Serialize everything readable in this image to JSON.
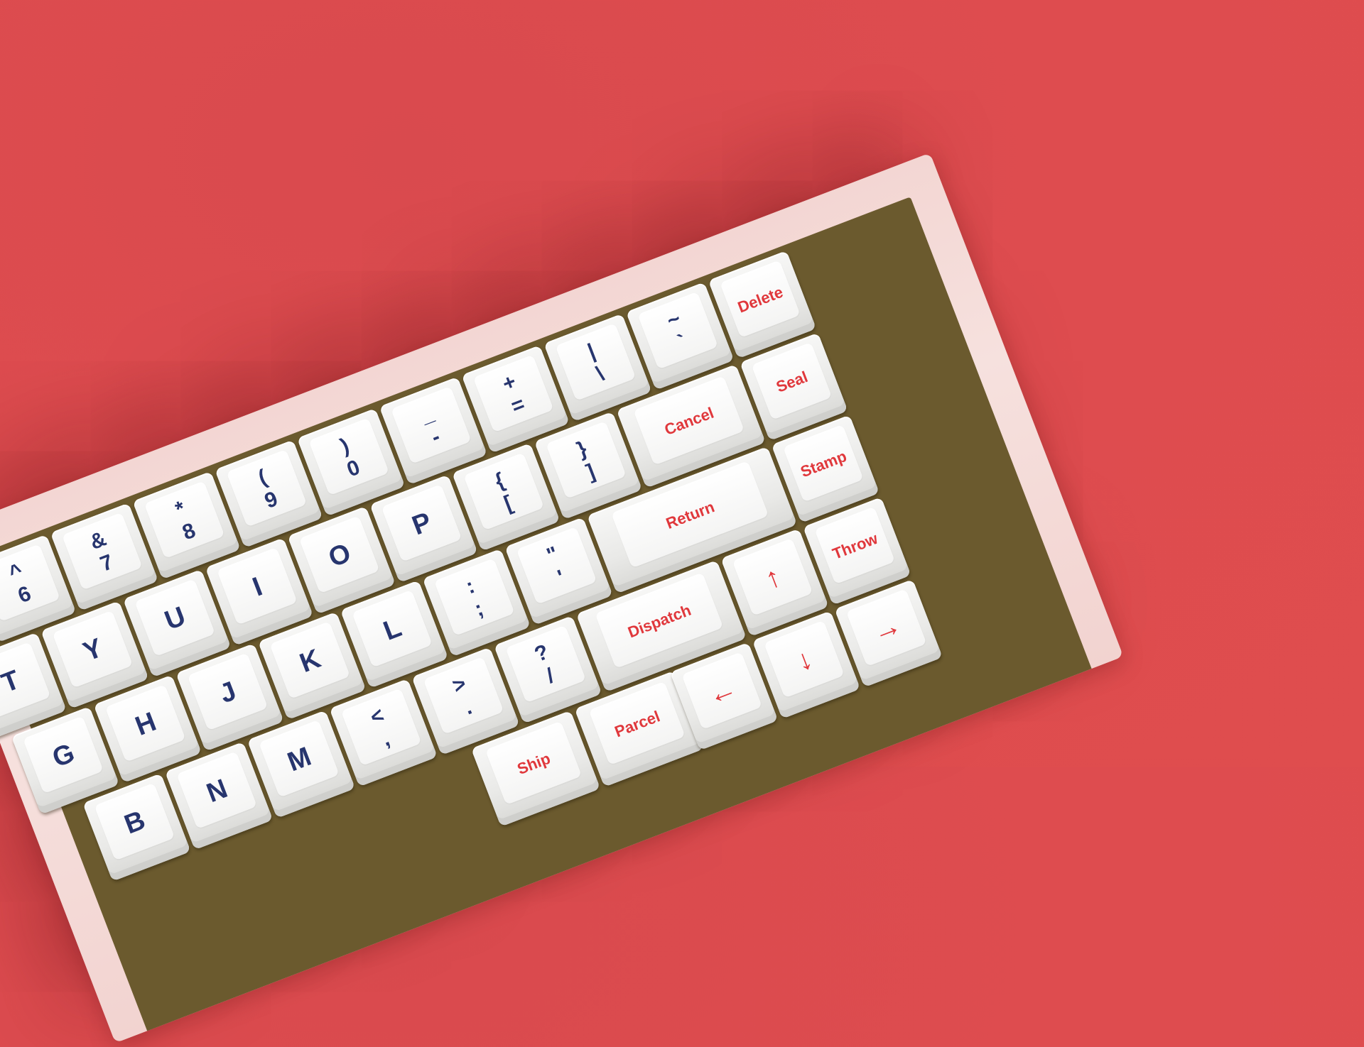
{
  "colors": {
    "background": "#de4c4f",
    "legend_blue": "#27356e",
    "legend_red": "#e0383c",
    "case": "#f4dcd9"
  },
  "rows": [
    [
      {
        "top": "^",
        "bottom": "6"
      },
      {
        "top": "&",
        "bottom": "7"
      },
      {
        "top": "*",
        "bottom": "8"
      },
      {
        "top": "(",
        "bottom": "9"
      },
      {
        "top": ")",
        "bottom": "0"
      },
      {
        "top": "_",
        "bottom": "-"
      },
      {
        "top": "+",
        "bottom": "="
      },
      {
        "top": "|",
        "bottom": "\\"
      },
      {
        "top": "~",
        "bottom": "`"
      },
      {
        "label": "Delete"
      }
    ],
    [
      {
        "label": "T"
      },
      {
        "label": "Y"
      },
      {
        "label": "U"
      },
      {
        "label": "I"
      },
      {
        "label": "O"
      },
      {
        "label": "P"
      },
      {
        "top": "{",
        "bottom": "["
      },
      {
        "top": "}",
        "bottom": "]"
      },
      {
        "label": "Cancel"
      },
      {
        "label": "Seal"
      }
    ],
    [
      {
        "label": "G"
      },
      {
        "label": "H"
      },
      {
        "label": "J"
      },
      {
        "label": "K"
      },
      {
        "label": "L"
      },
      {
        "top": ":",
        "bottom": ";"
      },
      {
        "top": "\"",
        "bottom": "'"
      },
      {
        "label": "Return"
      },
      {
        "label": "Stamp"
      }
    ],
    [
      {
        "label": "B"
      },
      {
        "label": "N"
      },
      {
        "label": "M"
      },
      {
        "top": "<",
        "bottom": ","
      },
      {
        "top": ">",
        "bottom": "."
      },
      {
        "top": "?",
        "bottom": "/"
      },
      {
        "label": "Dispatch"
      },
      {
        "label": "↑"
      },
      {
        "label": "Throw"
      }
    ],
    [
      {
        "label": "Ship"
      },
      {
        "label": "Parcel"
      },
      {
        "label": "←"
      },
      {
        "label": "↓"
      },
      {
        "label": "→"
      }
    ]
  ]
}
